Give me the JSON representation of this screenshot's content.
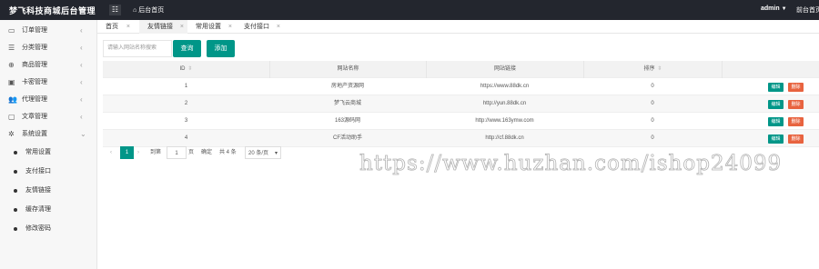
{
  "topbar": {
    "logo": "梦飞科技商城后台管理",
    "menu_toggle": "☷",
    "home": "后台首页",
    "admin": "admin",
    "front": "前台首页"
  },
  "sidebar": {
    "items": [
      {
        "label": "订单管理",
        "icon": "▭"
      },
      {
        "label": "分类管理",
        "icon": "☰"
      },
      {
        "label": "商品管理",
        "icon": "⊕"
      },
      {
        "label": "卡密管理",
        "icon": "▣"
      },
      {
        "label": "代理管理",
        "icon": "👥"
      },
      {
        "label": "文章管理",
        "icon": "▢"
      },
      {
        "label": "系统设置",
        "icon": "✲"
      }
    ],
    "sub_items": [
      "常用设置",
      "支付接口",
      "友情链接",
      "缓存清理",
      "修改密码"
    ]
  },
  "tabs": [
    {
      "label": "首页"
    },
    {
      "label": "友情链接"
    },
    {
      "label": "常用设置"
    },
    {
      "label": "支付接口"
    }
  ],
  "toolbar": {
    "search_placeholder": "请输入网站名称搜索",
    "query_label": "查询",
    "add_label": "添加"
  },
  "table": {
    "headers": [
      "ID",
      "网站名称",
      "网站链接",
      "排序"
    ],
    "rows": [
      {
        "id": "1",
        "name": "房地产资源网",
        "url": "https://www.88dk.cn",
        "sort": "0"
      },
      {
        "id": "2",
        "name": "梦飞云商城",
        "url": "http://yun.88dk.cn",
        "sort": "0"
      },
      {
        "id": "3",
        "name": "163源码网",
        "url": "http://www.163ymw.com",
        "sort": "0"
      },
      {
        "id": "4",
        "name": "CF活动助手",
        "url": "http://cf.88dk.cn",
        "sort": "0"
      }
    ],
    "edit_label": "编辑",
    "delete_label": "删除"
  },
  "pager": {
    "prev": "‹",
    "current": "1",
    "next": "›",
    "goto_label": "到第",
    "goto_value": "1",
    "page_unit": "页",
    "confirm": "确定",
    "total": "共 4 条",
    "per_page": "20 条/页"
  },
  "watermark": "https://www.huzhan.com/ishop24099",
  "colors": {
    "accent": "#009688",
    "danger": "#e8633f",
    "topbar": "#23262e"
  }
}
